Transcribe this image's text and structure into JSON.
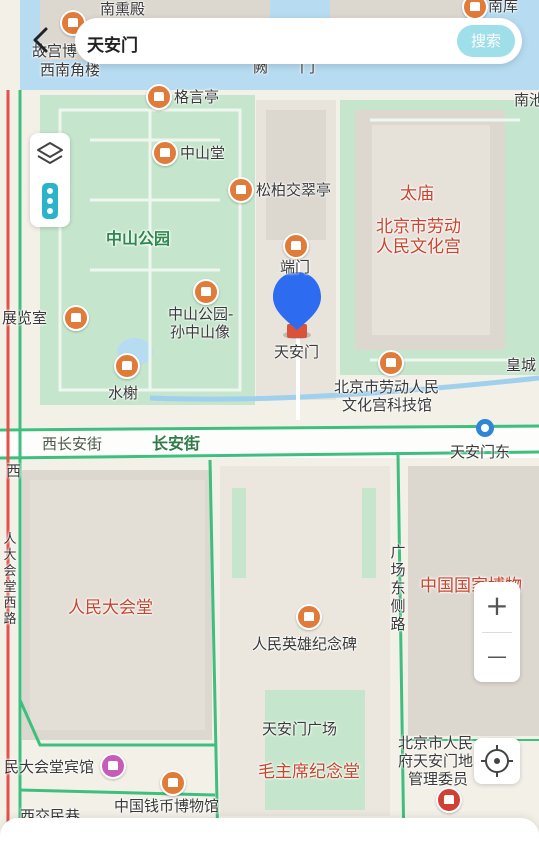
{
  "search": {
    "query": "天安门",
    "button_label": "搜索"
  },
  "colors": {
    "park": "#bfe3c9",
    "road_green": "#3fbf7f",
    "road_red": "#e5504a",
    "water": "#b7dcf2",
    "building": "#dcd8d0",
    "marker": "#2d6cf0",
    "poi_orange": "#e07b39"
  },
  "labels": {
    "nanxundian": "南熏殿",
    "nanku": "南库",
    "gugong": "故宫博",
    "xinanjiaolou": "西南角楼",
    "que": "阙",
    "men": "门",
    "nanchi": "南池",
    "geyanting": "格言亭",
    "zhongshantang": "中山堂",
    "songbai": "松柏交翠亭",
    "taimiao": "太庙",
    "laodong_line1": "北京市劳动",
    "laodong_line2": "人民文化宫",
    "zhongshan_park": "中山公园",
    "duanmen": "端门",
    "zhanlanshi": "展览室",
    "sunzhongshan_line1": "中山公园-",
    "sunzhongshan_line2": "孙中山像",
    "tiananmen": "天安门",
    "huangcheng": "皇城",
    "shuixie": "水榭",
    "keji_line1": "北京市劳动人民",
    "keji_line2": "文化宫科技馆",
    "xichangan": "西长安街",
    "changan": "长安街",
    "tiananmen_east": "天安门东",
    "xi": "西",
    "dongce": "广场东侧路",
    "national_museum": "中国国家博物",
    "great_hall": "人民大会堂",
    "great_hall_west": "人大会堂西路",
    "monument": "人民英雄纪念碑",
    "square": "天安门广场",
    "mausoleum": "毛主席纪念堂",
    "govt_line1": "北京市人民",
    "govt_line2": "府天安门地",
    "govt_line3": "管理委员",
    "guest_house": "民大会堂宾馆",
    "coin_museum": "中国钱币博物馆",
    "xijiaomin": "西交民巷"
  },
  "controls": {
    "zoom_in": "+",
    "zoom_out": "—"
  }
}
